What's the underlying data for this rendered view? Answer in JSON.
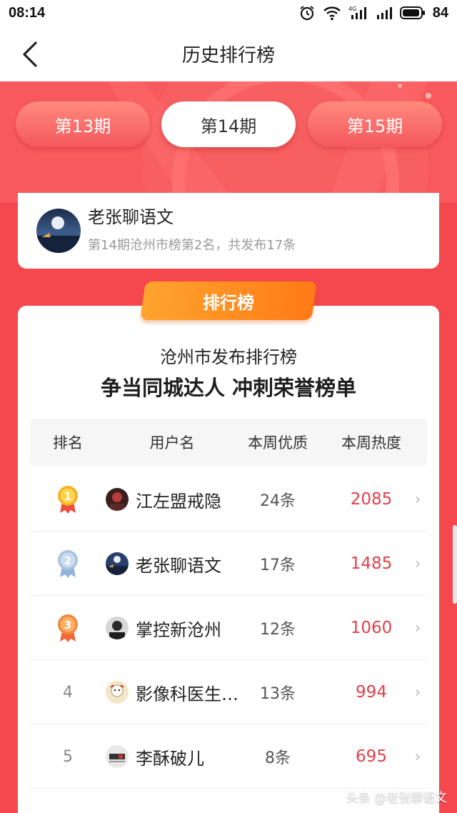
{
  "status_bar": {
    "time": "08:14",
    "battery": "84",
    "network": "4G"
  },
  "nav": {
    "title": "历史排行榜"
  },
  "periods": [
    {
      "label": "第13期",
      "active": false
    },
    {
      "label": "第14期",
      "active": true
    },
    {
      "label": "第15期",
      "active": false
    }
  ],
  "profile": {
    "name": "老张聊语文",
    "subtitle": "第14期沧州市榜第2名，共发布17条"
  },
  "badge": {
    "label": "排行榜"
  },
  "card": {
    "title": "沧州市发布排行榜",
    "slogan": "争当同城达人 冲刺荣誉榜单"
  },
  "table": {
    "headers": {
      "rank": "排名",
      "user": "用户名",
      "quality": "本周优质",
      "heat": "本周热度"
    },
    "rows": [
      {
        "rank": "1",
        "medal": "gold",
        "name": "江左盟戒隐",
        "quality": "24条",
        "heat": "2085"
      },
      {
        "rank": "2",
        "medal": "silver",
        "name": "老张聊语文",
        "quality": "17条",
        "heat": "1485"
      },
      {
        "rank": "3",
        "medal": "bronze",
        "name": "掌控新沧州",
        "quality": "12条",
        "heat": "1060"
      },
      {
        "rank": "4",
        "medal": "none",
        "name": "影像科医生…",
        "quality": "13条",
        "heat": "994"
      },
      {
        "rank": "5",
        "medal": "none",
        "name": "李酥破儿",
        "quality": "8条",
        "heat": "695"
      }
    ],
    "arrow": "›"
  },
  "colors": {
    "primary_red": "#f5484e",
    "heat_red": "#e5404a",
    "badge_orange": "#ff8a1e"
  },
  "watermark": "头条 @老张聊语文"
}
